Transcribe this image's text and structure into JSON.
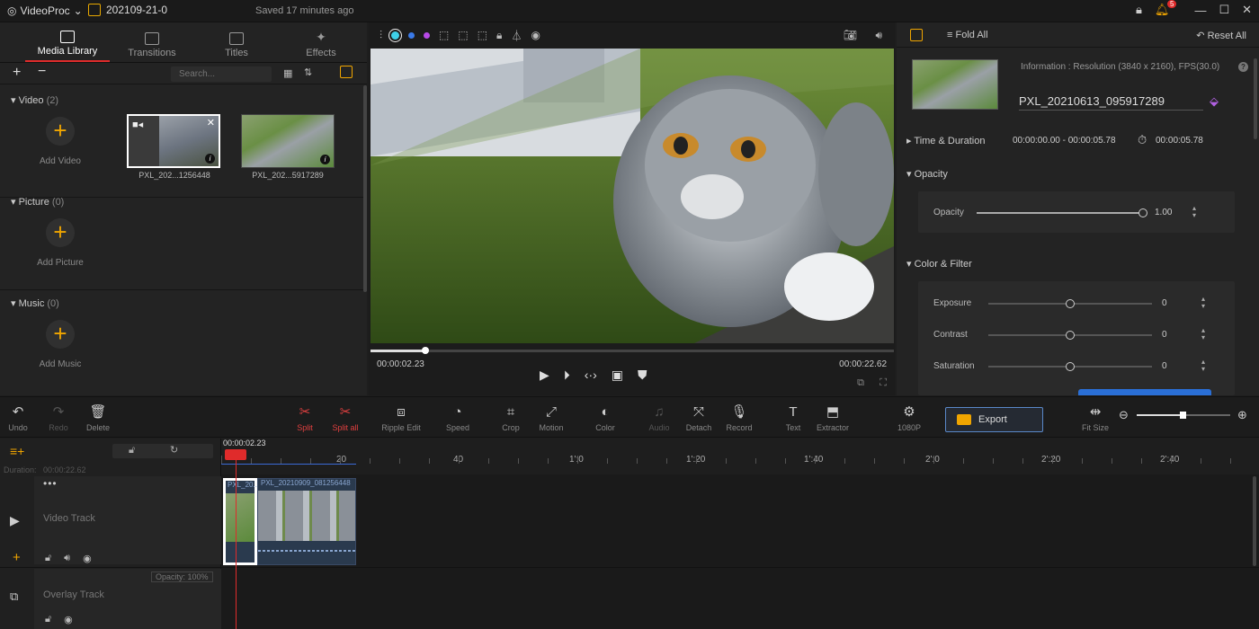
{
  "titlebar": {
    "app_name": "VideoProc",
    "project_name": "202109-21-0",
    "saved_status": "Saved 17 minutes ago",
    "notification_count": "5"
  },
  "library": {
    "tabs": [
      {
        "label": "Media Library"
      },
      {
        "label": "Transitions"
      },
      {
        "label": "Titles"
      },
      {
        "label": "Effects"
      }
    ],
    "search_placeholder": "Search...",
    "sections": [
      {
        "title": "Video",
        "count": "(2)",
        "add_label": "Add Video"
      },
      {
        "title": "Picture",
        "count": "(0)",
        "add_label": "Add Picture"
      },
      {
        "title": "Music",
        "count": "(0)",
        "add_label": "Add Music"
      }
    ],
    "videos": [
      {
        "name": "PXL_202...1256448"
      },
      {
        "name": "PXL_202...5917289"
      }
    ]
  },
  "preview": {
    "current_time": "00:00:02.23",
    "total_time": "00:00:22.62",
    "progress": 0.104,
    "dot_colors": [
      "#3fd0e8",
      "#3a7ae8",
      "#b84ae8"
    ]
  },
  "inspector": {
    "fold_all": "Fold All",
    "reset_all": "Reset All",
    "info": "Information : Resolution (3840 x 2160), FPS(30.0)",
    "file_name": "PXL_20210613_095917289",
    "time_duration_label": "Time & Duration",
    "time_range": "00:00:00.00 - 00:00:05.78",
    "duration": "00:00:05.78",
    "opacity_section": "Opacity",
    "opacity_label": "Opacity",
    "opacity_value": "1.00",
    "color_filter_section": "Color & Filter",
    "adjustments": [
      {
        "label": "Exposure",
        "value": "0"
      },
      {
        "label": "Contrast",
        "value": "0"
      },
      {
        "label": "Saturation",
        "value": "0"
      }
    ]
  },
  "toolbar": {
    "undo": "Undo",
    "redo": "Redo",
    "delete": "Delete",
    "split": "Split",
    "split_all": "Split all",
    "ripple_edit": "Ripple Edit",
    "speed": "Speed",
    "crop": "Crop",
    "motion": "Motion",
    "color": "Color",
    "audio": "Audio",
    "detach": "Detach",
    "record": "Record",
    "text": "Text",
    "extractor": "Extractor",
    "resolution": "1080P",
    "export": "Export",
    "fit_size": "Fit Size"
  },
  "timeline": {
    "playhead_time": "00:00:02.23",
    "duration_label": "Duration:",
    "duration_value": "00:00:22.62",
    "ruler_labels": [
      "20",
      "40",
      "1':0",
      "1':20",
      "1':40",
      "2':0",
      "2':20",
      "2':40"
    ],
    "tracks": [
      {
        "label": "Video Track"
      },
      {
        "label": "Overlay Track",
        "opacity": "Opacity: 100%"
      }
    ],
    "clips": [
      {
        "name": "PXL_20..."
      },
      {
        "name": "PXL_20210909_081256448"
      }
    ]
  }
}
